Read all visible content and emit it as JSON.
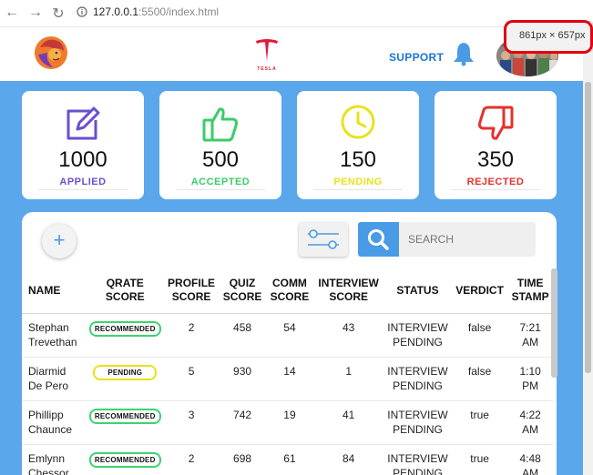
{
  "browser": {
    "host": "127.0.0.1",
    "path": ":5500/index.html"
  },
  "header": {
    "support_label": "SUPPORT",
    "tesla_text": "TESLA",
    "dimension_popup": "861px × 657px"
  },
  "cards": [
    {
      "value": "1000",
      "label": "APPLIED",
      "color": "#6a4fd0",
      "icon": "edit-icon"
    },
    {
      "value": "500",
      "label": "ACCEPTED",
      "color": "#3bcc6a",
      "icon": "thumbs-up-icon"
    },
    {
      "value": "150",
      "label": "PENDING",
      "color": "#e9e11f",
      "icon": "clock-icon"
    },
    {
      "value": "350",
      "label": "REJECTED",
      "color": "#e3322e",
      "icon": "thumbs-down-icon"
    }
  ],
  "toolbar": {
    "add_label": "+",
    "search_placeholder": "SEARCH"
  },
  "table": {
    "headers": {
      "name": "NAME",
      "qrate": [
        "QRATE",
        "SCORE"
      ],
      "profile": [
        "PROFILE",
        "SCORE"
      ],
      "quiz": [
        "QUIZ",
        "SCORE"
      ],
      "comm": [
        "COMM",
        "SCORE"
      ],
      "interview": [
        "INTERVIEW",
        "SCORE"
      ],
      "status": "STATUS",
      "verdict": "VERDICT",
      "time": [
        "TIME",
        "STAMP"
      ]
    },
    "rows": [
      {
        "name": [
          "Stephan",
          "Trevethan"
        ],
        "qrate": "RECOMMENDED",
        "qrate_kind": "rec",
        "profile": "2",
        "quiz": "458",
        "comm": "54",
        "interview": "43",
        "status": [
          "INTERVIEW",
          "PENDING"
        ],
        "verdict": "false",
        "time": [
          "7:21",
          "AM"
        ]
      },
      {
        "name": [
          "Diarmid",
          "De Pero"
        ],
        "qrate": "PENDING",
        "qrate_kind": "pen",
        "profile": "5",
        "quiz": "930",
        "comm": "14",
        "interview": "1",
        "status": [
          "INTERVIEW",
          "PENDING"
        ],
        "verdict": "false",
        "time": [
          "1:10",
          "PM"
        ]
      },
      {
        "name": [
          "Phillipp",
          "Chaunce"
        ],
        "qrate": "RECOMMENDED",
        "qrate_kind": "rec",
        "profile": "3",
        "quiz": "742",
        "comm": "19",
        "interview": "41",
        "status": [
          "INTERVIEW",
          "PENDING"
        ],
        "verdict": "true",
        "time": [
          "4:22",
          "AM"
        ]
      },
      {
        "name": [
          "Emlynn",
          "Chessor"
        ],
        "qrate": "RECOMMENDED",
        "qrate_kind": "rec",
        "profile": "2",
        "quiz": "698",
        "comm": "61",
        "interview": "84",
        "status": [
          "INTERVIEW",
          "PENDING"
        ],
        "verdict": "true",
        "time": [
          "4:48",
          "AM"
        ]
      }
    ]
  }
}
